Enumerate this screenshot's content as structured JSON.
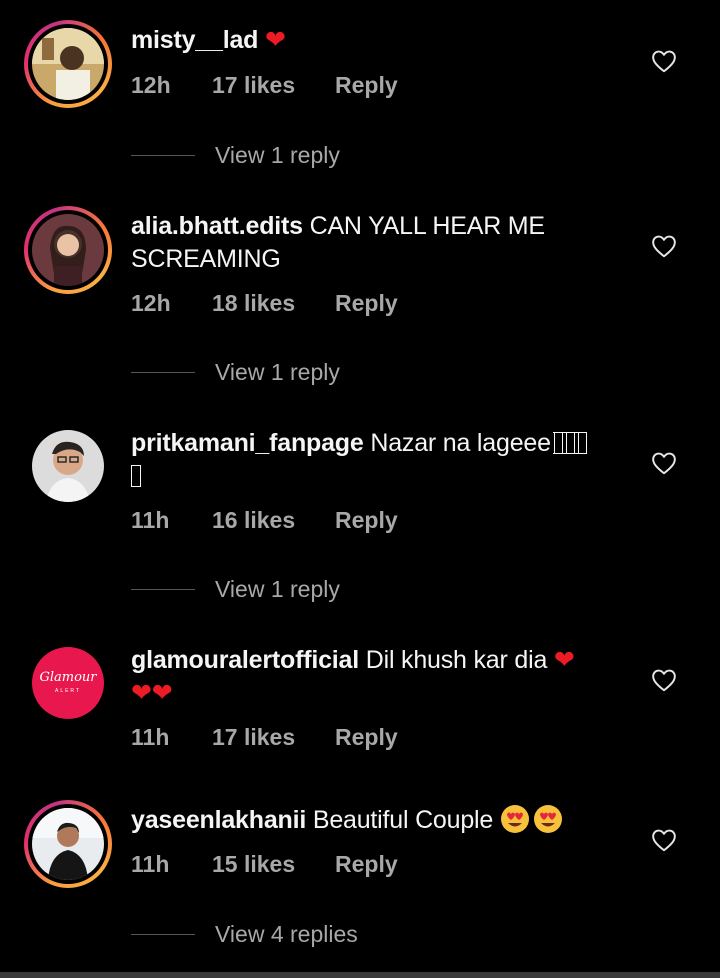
{
  "comments": [
    {
      "username": "misty__lad",
      "text": " ❤",
      "time": "12h",
      "likes": "17 likes",
      "reply": "Reply",
      "view_replies": "View 1 reply"
    },
    {
      "username": "alia.bhatt.edits",
      "text": " CAN YALL HEAR ME SCREAMING",
      "time": "12h",
      "likes": "18 likes",
      "reply": "Reply",
      "view_replies": "View 1 reply"
    },
    {
      "username": "pritkamani_fanpage",
      "text": " Nazar na lageee",
      "text_tail": "",
      "time": "11h",
      "likes": "16 likes",
      "reply": "Reply",
      "view_replies": "View 1 reply"
    },
    {
      "username": "glamouralertofficial",
      "text": " Dil khush kar dia ",
      "time": "11h",
      "likes": "17 likes",
      "reply": "Reply",
      "avatar_text": "Glamour",
      "avatar_subtext": "ALERT"
    },
    {
      "username": "yaseenlakhanii",
      "text": " Beautiful Couple ",
      "time": "11h",
      "likes": "15 likes",
      "reply": "Reply",
      "view_replies": "View 4 replies"
    }
  ],
  "colors": {
    "background": "#000000",
    "secondary_text": "#a8a8a8",
    "heart_emoji": "#ed1c24",
    "avatar_glamour_bg": "#e8184f"
  },
  "icons": {
    "like": "heart-outline-icon",
    "emoji_heart": "red-heart-emoji",
    "emoji_heart_eyes": "heart-eyes-emoji",
    "missing_glyph": "missing-glyph-box"
  }
}
